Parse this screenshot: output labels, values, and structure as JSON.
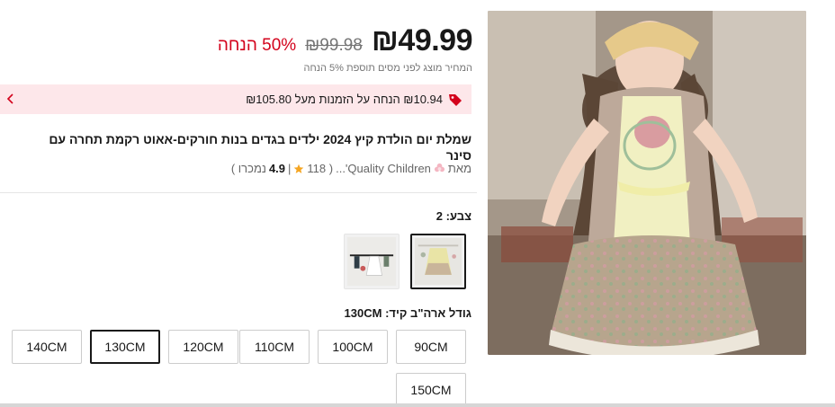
{
  "price": {
    "current": "₪49.99",
    "original": "₪99.98",
    "discount": "50% הנחה",
    "tax_note": "המחיר מוצג לפני מסים תוספת 5% הנחה"
  },
  "coupon": {
    "text": "₪10.94 הנחה על הזמנות מעל ₪105.80"
  },
  "product": {
    "title": "שמלת יום הולדת קיץ 2024 ילדים בגדים בנות חורקים-אאוט רקמת תחרה עם סינר"
  },
  "store": {
    "prefix": "מאת",
    "name": "Quality Children'...",
    "reviews": "( 118",
    "separator": "|",
    "rating": "4.9",
    "sold": "נמכרו )"
  },
  "color": {
    "label": "צבע: 2",
    "options": [
      "color-option-2",
      "color-option-1"
    ]
  },
  "size": {
    "label": "גודל ארה\"ב קיד: 130CM",
    "options": [
      "90CM",
      "100CM",
      "110CM",
      "120CM",
      "130CM",
      "140CM",
      "150CM"
    ],
    "selected": "130CM"
  },
  "colors": {
    "price_red": "#d3031c",
    "coupon_bg": "#fde7ea",
    "star": "#f5a623"
  },
  "icons": {
    "coupon": "tag-icon",
    "arrow": "chevron-left-icon",
    "store": "flower-icon",
    "rating": "star-icon"
  }
}
